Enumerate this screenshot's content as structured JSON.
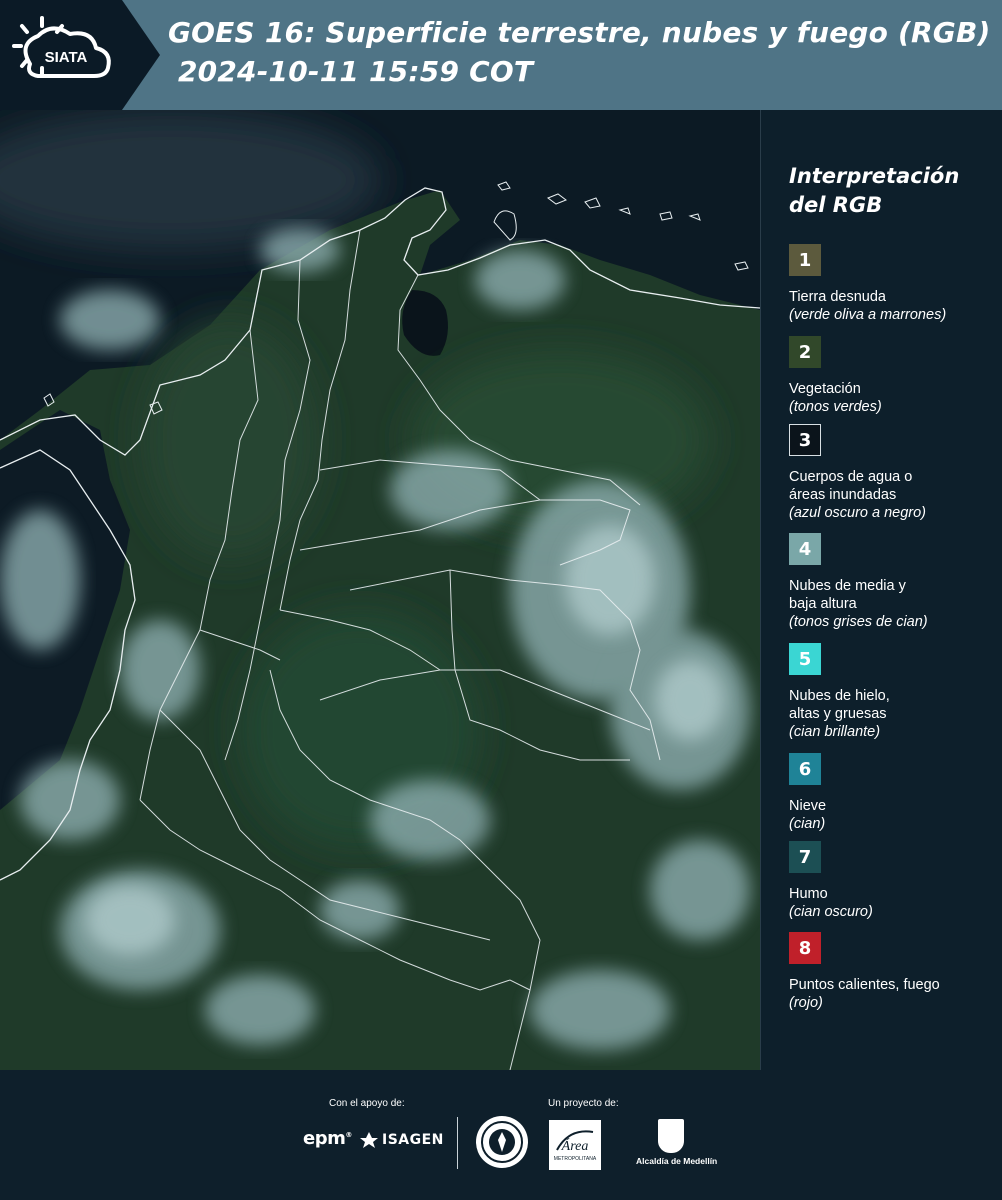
{
  "header": {
    "logo_text": "SIATA",
    "title_line1": "GOES 16: Superficie terrestre, nubes y fuego (RGB)",
    "title_line2": "2024-10-11 15:59 COT"
  },
  "legend": {
    "title_line1": "Interpretación",
    "title_line2": "del RGB",
    "items": [
      {
        "number": "1",
        "color": "#5c5a3d",
        "label": "Tierra desnuda",
        "note": "(verde oliva a marrones)"
      },
      {
        "number": "2",
        "color": "#31482a",
        "label": "Vegetación",
        "note": "(tonos verdes)"
      },
      {
        "number": "3",
        "color": "#0b141b",
        "label": "Cuerpos de agua o\náreas inundadas",
        "note": "(azul oscuro a negro)"
      },
      {
        "number": "4",
        "color": "#7aa7a8",
        "label": "Nubes de media y\nbaja altura",
        "note": "(tonos grises de cian)"
      },
      {
        "number": "5",
        "color": "#3ad6d3",
        "label": "Nubes de hielo,\naltas y gruesas",
        "note": "(cian brillante)"
      },
      {
        "number": "6",
        "color": "#1f8397",
        "label": "Nieve",
        "note": "(cian)"
      },
      {
        "number": "7",
        "color": "#1c4f54",
        "label": "Humo",
        "note": "(cian oscuro)"
      },
      {
        "number": "8",
        "color": "#c0202a",
        "label": "Puntos calientes, fuego",
        "note": "(rojo)"
      }
    ]
  },
  "footer": {
    "support_caption": "Con el apoyo de:",
    "project_caption": "Un proyecto de:",
    "epm": "epm",
    "isagen": "ISAGEN",
    "area_name": "Área",
    "area_sub": "METROPOLITANA",
    "alcaldia": "Alcaldía de Medellín"
  },
  "colors": {
    "header_bg": "#4f7486",
    "logo_bg": "#0b1a26",
    "page_bg": "#0f1e2a",
    "ocean": "#0c1a24",
    "land": "#1f3a29",
    "cloud": "#8fb0b2",
    "boundary": "#e8eef0"
  }
}
